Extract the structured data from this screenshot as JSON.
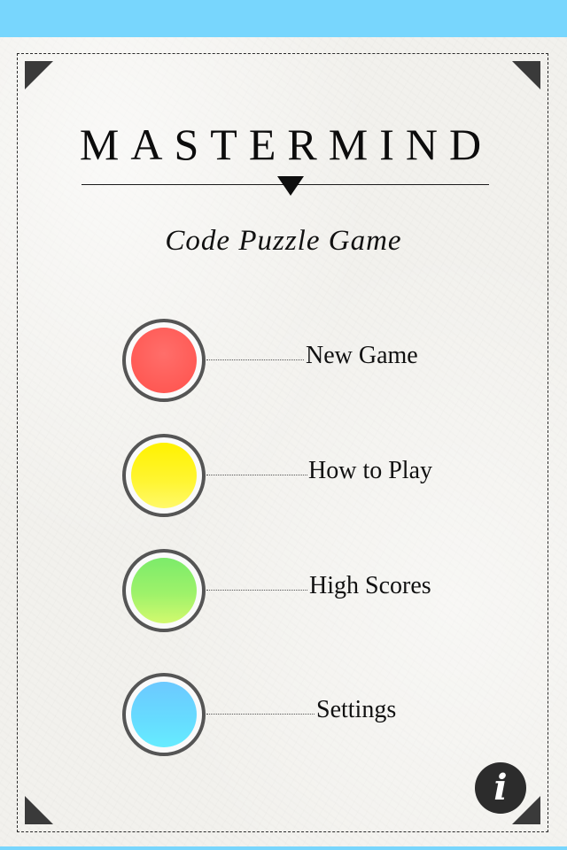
{
  "app": {
    "title": "MASTERMIND",
    "subtitle": "Code Puzzle Game"
  },
  "menu": {
    "items": [
      {
        "label": "New Game",
        "color": "#ff605c"
      },
      {
        "label": "How to Play",
        "color": "#fff200"
      },
      {
        "label": "High Scores",
        "color": "#84ed6a"
      },
      {
        "label": "Settings",
        "color": "#66d2ff"
      }
    ]
  },
  "info_button": {
    "label": "i",
    "icon": "info-icon"
  },
  "colors": {
    "status_bar": "#78d6fd",
    "paper": "#f2f1ed",
    "ink": "#111111"
  }
}
